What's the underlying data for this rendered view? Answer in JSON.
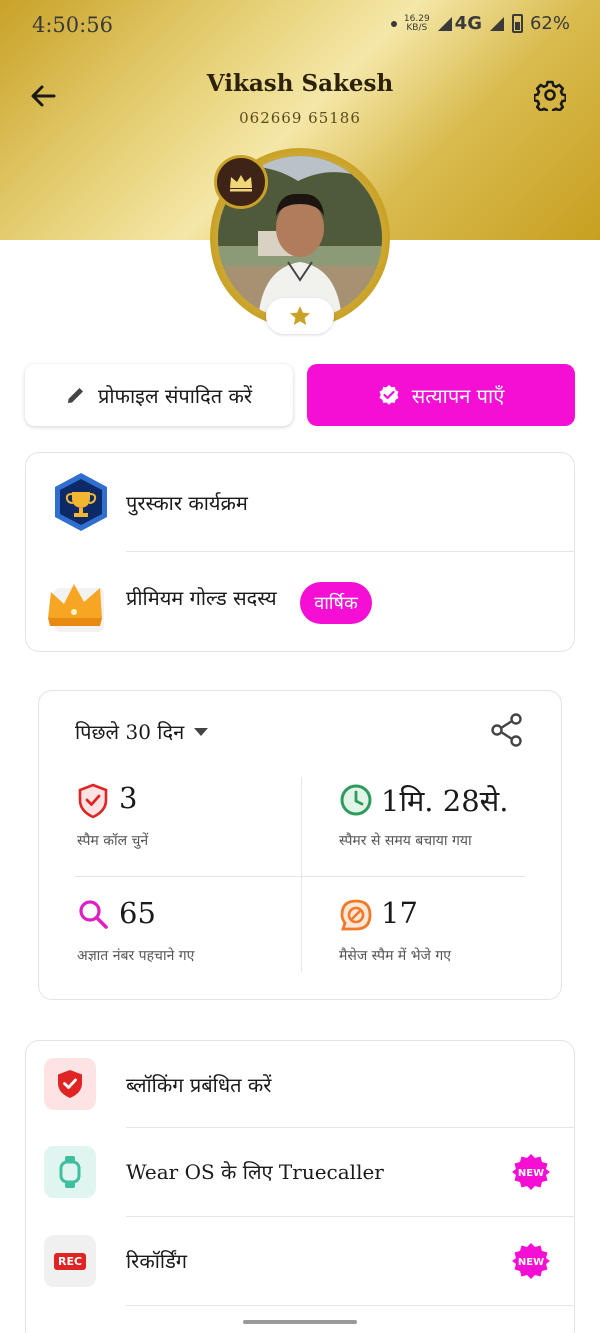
{
  "status_bar": {
    "time": "4:50:56",
    "net_speed_value": "16.29",
    "net_speed_unit": "KB/S",
    "network": "4G",
    "battery": "62%"
  },
  "profile": {
    "name": "Vikash Sakesh",
    "phone": "062669 65186"
  },
  "actions": {
    "edit_label": "प्रोफाइल संपादित करें",
    "verify_label": "सत्यापन पाएँ"
  },
  "membership": {
    "rewards_label": "पुरस्कार कार्यक्रम",
    "premium_label": "प्रीमियम गोल्ड सदस्य",
    "premium_badge": "वार्षिक"
  },
  "stats": {
    "period_label": "पिछले 30 दिन",
    "items": [
      {
        "value": "3",
        "label": "स्पैम कॉल चुनें"
      },
      {
        "value": "1मि. 28से.",
        "label": "स्पैमर से समय बचाया गया"
      },
      {
        "value": "65",
        "label": "अज्ञात नंबर पहचाने गए"
      },
      {
        "value": "17",
        "label": "मैसेज स्पैम में भेजे गए"
      }
    ]
  },
  "menu": {
    "items": [
      {
        "label": "ब्लॉकिंग प्रबंधित करें",
        "icon": "shield-check-icon"
      },
      {
        "label": "Wear OS के लिए Truecaller",
        "icon": "smartwatch-icon",
        "badge": "NEW"
      },
      {
        "label": "रिकॉर्डिंग",
        "icon": "rec-icon",
        "icon_text": "REC",
        "badge": "NEW"
      }
    ]
  },
  "colors": {
    "accent": "#f50fd5",
    "gold": "#c9a227",
    "red": "#e02424",
    "green": "#2e9b5c",
    "orange": "#f07a2a"
  }
}
